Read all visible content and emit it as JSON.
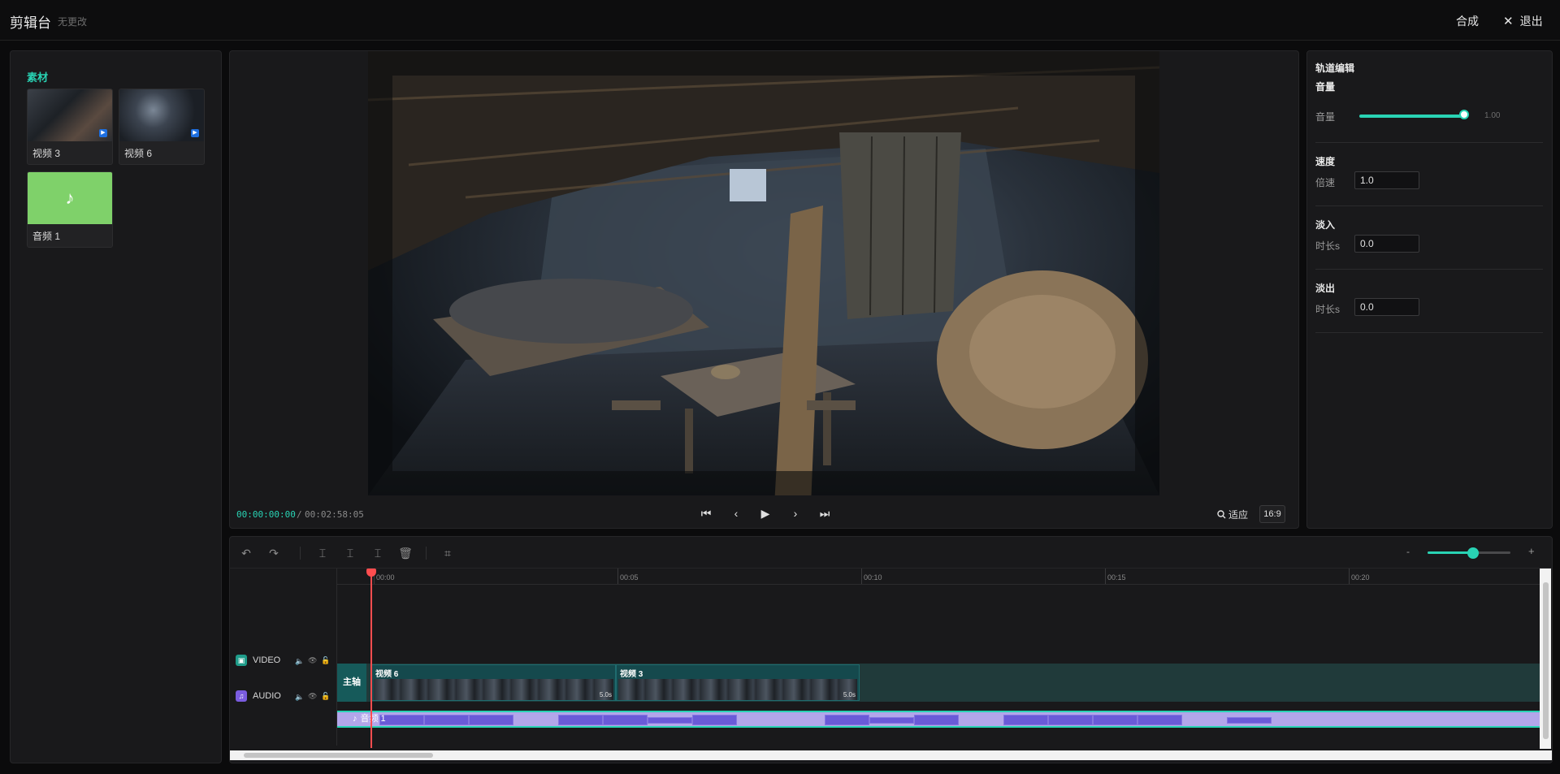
{
  "header": {
    "title": "剪辑台",
    "status": "无更改",
    "compose_label": "合成",
    "exit_label": "退出"
  },
  "media": {
    "title": "素材",
    "items": [
      {
        "label": "视频 3",
        "type": "video"
      },
      {
        "label": "视频 6",
        "type": "video"
      },
      {
        "label": "音频 1",
        "type": "audio",
        "icon": "♪"
      }
    ]
  },
  "preview": {
    "current_time": "00:00:00:00",
    "separator": "/",
    "duration": "00:02:58:05",
    "fit_label": "适应",
    "aspect_ratio": "16:9"
  },
  "track_edit": {
    "title": "轨道编辑",
    "volume": {
      "section": "音量",
      "label": "音量",
      "value": "1.00",
      "level": 1.0
    },
    "speed": {
      "section": "速度",
      "label": "倍速",
      "value": "1.0"
    },
    "fade_in": {
      "section": "淡入",
      "label": "时长s",
      "value": "0.0"
    },
    "fade_out": {
      "section": "淡出",
      "label": "时长s",
      "value": "0.0"
    }
  },
  "timeline": {
    "zoom_minus": "-",
    "zoom_plus": "+",
    "zoom_level": 0.55,
    "ruler": [
      "00:00",
      "00:05",
      "00:10",
      "00:15",
      "00:20"
    ],
    "tracks": {
      "video": {
        "label": "VIDEO",
        "main_tag": "主轴"
      },
      "audio": {
        "label": "AUDIO"
      }
    },
    "clips": {
      "video": [
        {
          "name": "视频 6",
          "duration": "5.0s"
        },
        {
          "name": "视频 3",
          "duration": "5.0s"
        }
      ],
      "audio": [
        {
          "name": "音频 1"
        }
      ]
    }
  },
  "colors": {
    "accent": "#29d3b4",
    "playhead": "#ff4d4f",
    "audio_clip": "#b3a6ea",
    "video_clip": "#15494d"
  }
}
